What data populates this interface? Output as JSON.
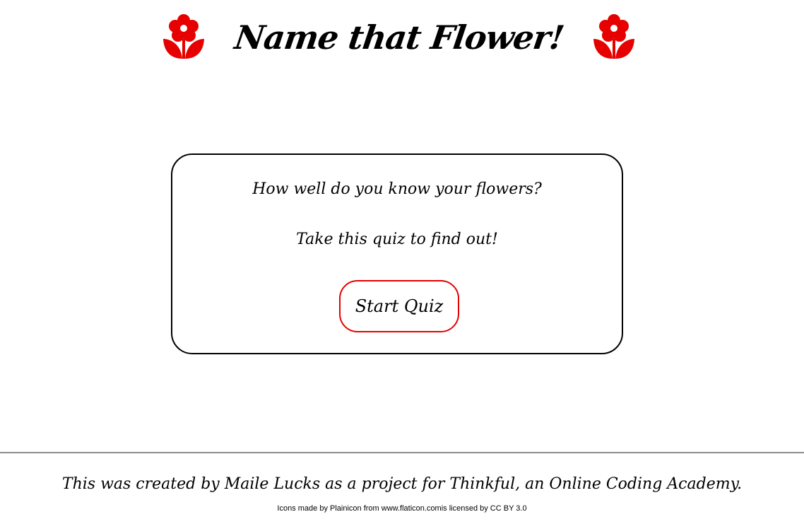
{
  "header": {
    "title": "Name that Flower!",
    "left_icon": "flower-icon",
    "right_icon": "flower-icon"
  },
  "quiz_card": {
    "question_line_1": "How well do you know your flowers?",
    "question_line_2": "Take this quiz to find out!",
    "start_button_label": "Start Quiz"
  },
  "footer": {
    "credit": "This was created by Maile Lucks as a project for Thinkful, an Online Coding Academy.",
    "attribution": "Icons made by Plainicon from www.flaticon.comis licensed by CC BY 3.0"
  },
  "colors": {
    "accent": "#e60000",
    "text": "#000000",
    "divider": "#8c8c8c",
    "background": "#ffffff"
  }
}
